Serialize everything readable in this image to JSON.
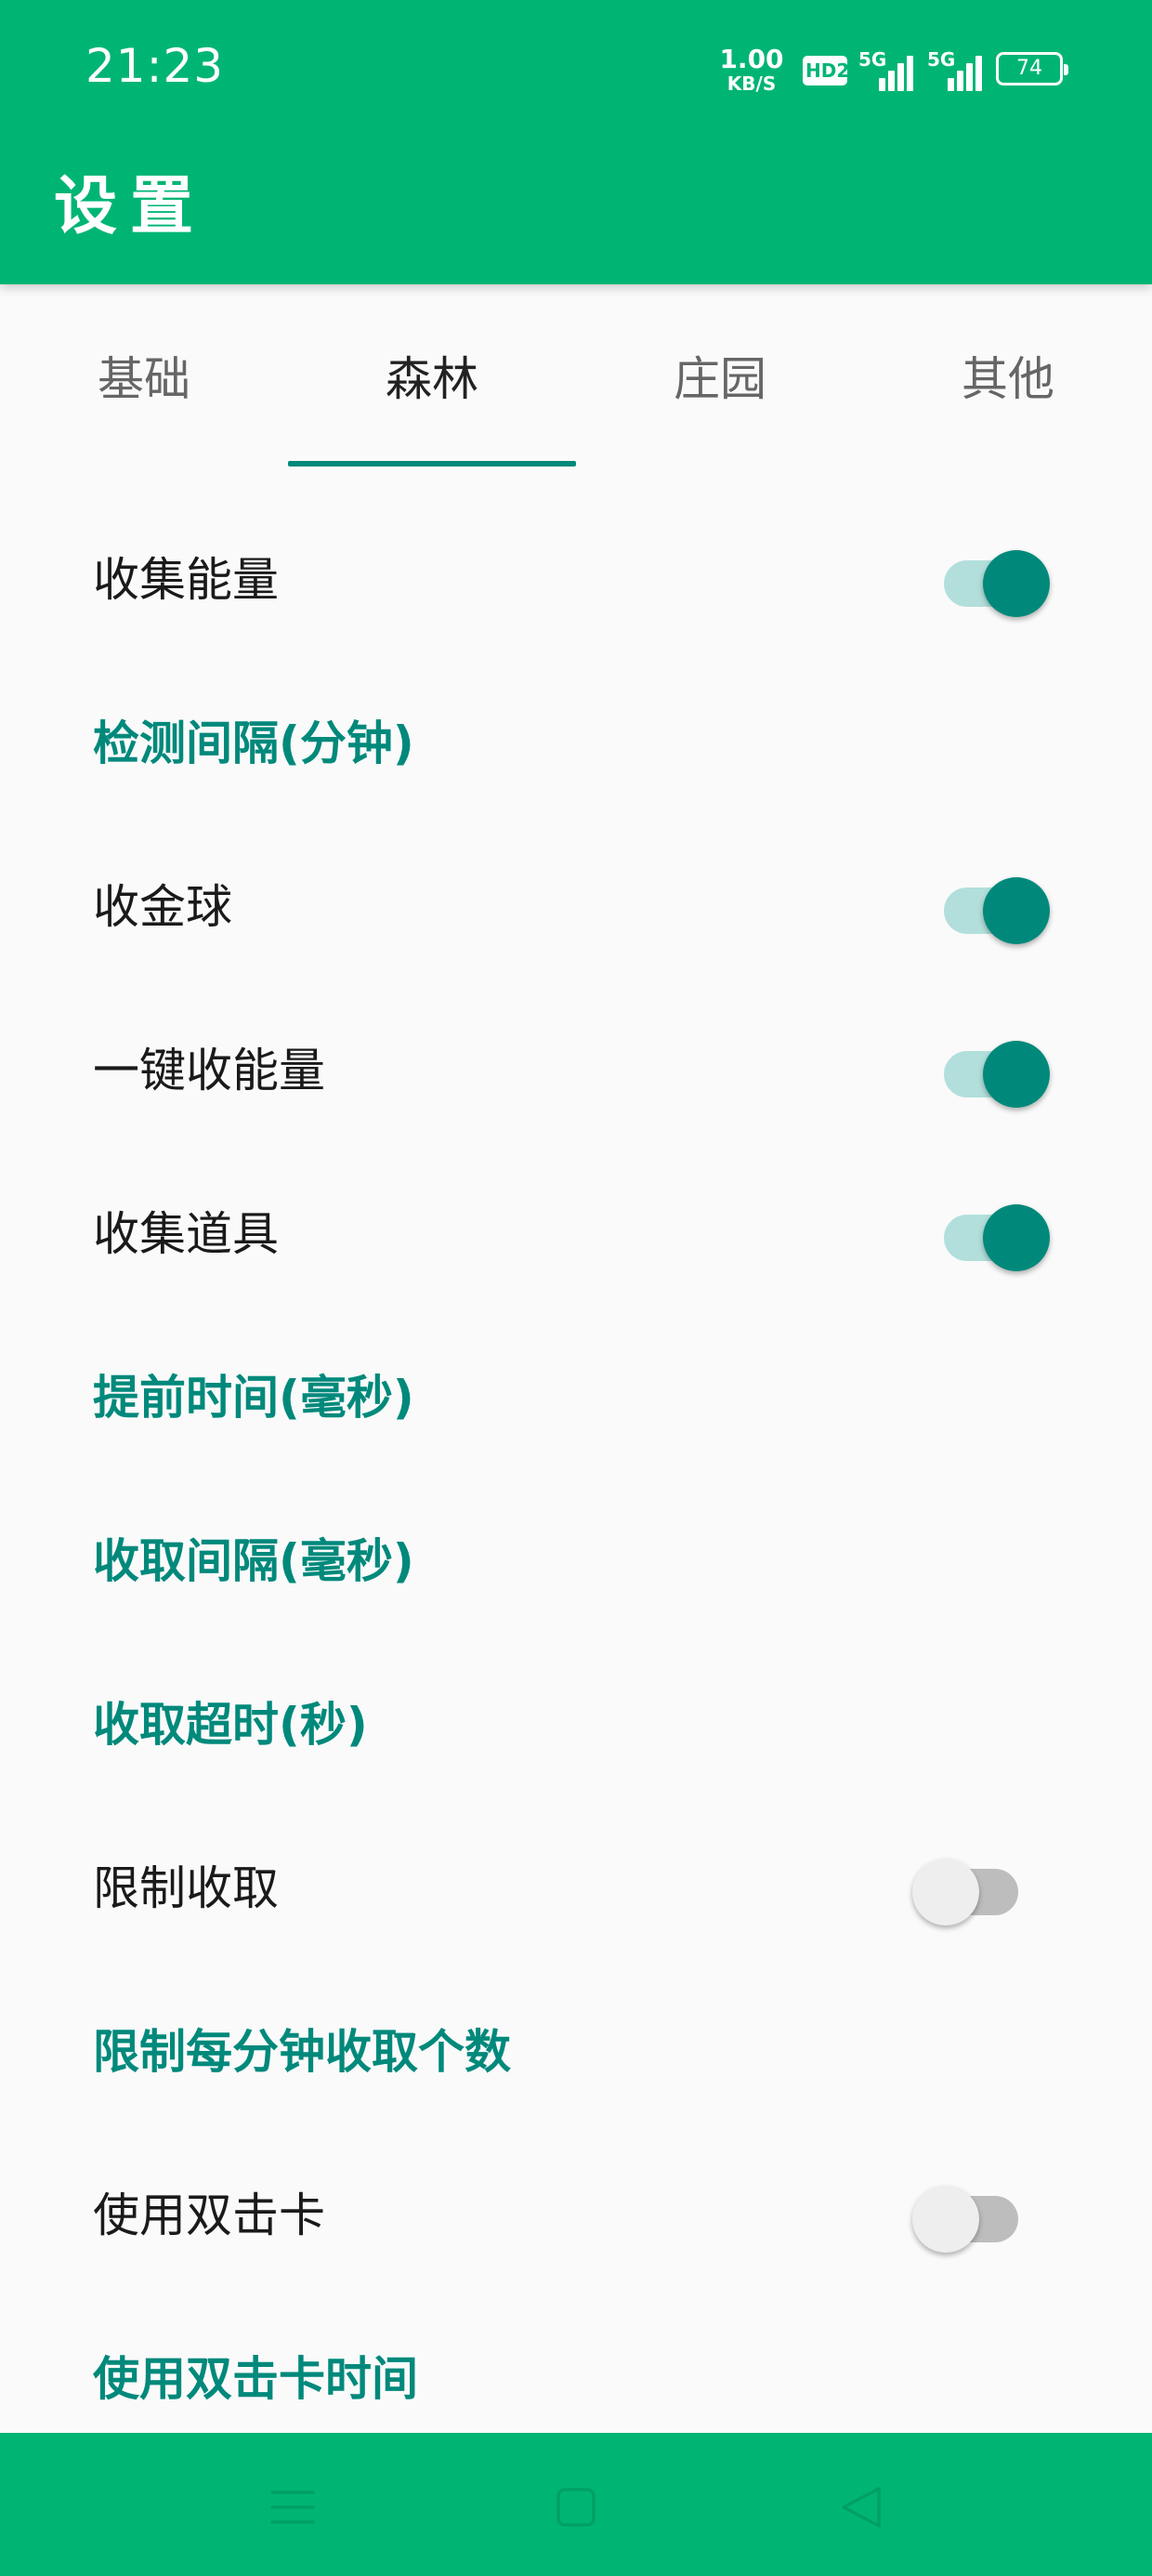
{
  "status_bar": {
    "time": "21:23",
    "net_speed_value": "1.00",
    "net_speed_unit": "KB/S",
    "hd_badge": "HD2",
    "signal_1_label": "5G",
    "signal_2_label": "5G",
    "battery": "74"
  },
  "app_bar": {
    "title": "设置"
  },
  "tabs": [
    {
      "label": "基础",
      "selected": false
    },
    {
      "label": "森林",
      "selected": true
    },
    {
      "label": "庄园",
      "selected": false
    },
    {
      "label": "其他",
      "selected": false
    }
  ],
  "settings": [
    {
      "label": "收集能量",
      "type": "switch",
      "checked": true
    },
    {
      "label": "检测间隔(分钟)",
      "type": "link"
    },
    {
      "label": "收金球",
      "type": "switch",
      "checked": true
    },
    {
      "label": "一键收能量",
      "type": "switch",
      "checked": true
    },
    {
      "label": "收集道具",
      "type": "switch",
      "checked": true
    },
    {
      "label": "提前时间(毫秒)",
      "type": "link"
    },
    {
      "label": "收取间隔(毫秒)",
      "type": "link"
    },
    {
      "label": "收取超时(秒)",
      "type": "link"
    },
    {
      "label": "限制收取",
      "type": "switch",
      "checked": false
    },
    {
      "label": "限制每分钟收取个数",
      "type": "link"
    },
    {
      "label": "使用双击卡",
      "type": "switch",
      "checked": false
    },
    {
      "label": "使用双击卡时间",
      "type": "link"
    }
  ],
  "navigation": [
    {
      "icon": "menu-icon"
    },
    {
      "icon": "home-square-icon"
    },
    {
      "icon": "back-triangle-icon"
    }
  ],
  "colors": {
    "primary": "#00b574",
    "accent": "#00897b",
    "switch_track_on": "#b2dfdb",
    "switch_track_off": "#bdbdbd",
    "switch_thumb_off": "#eeeeee"
  }
}
